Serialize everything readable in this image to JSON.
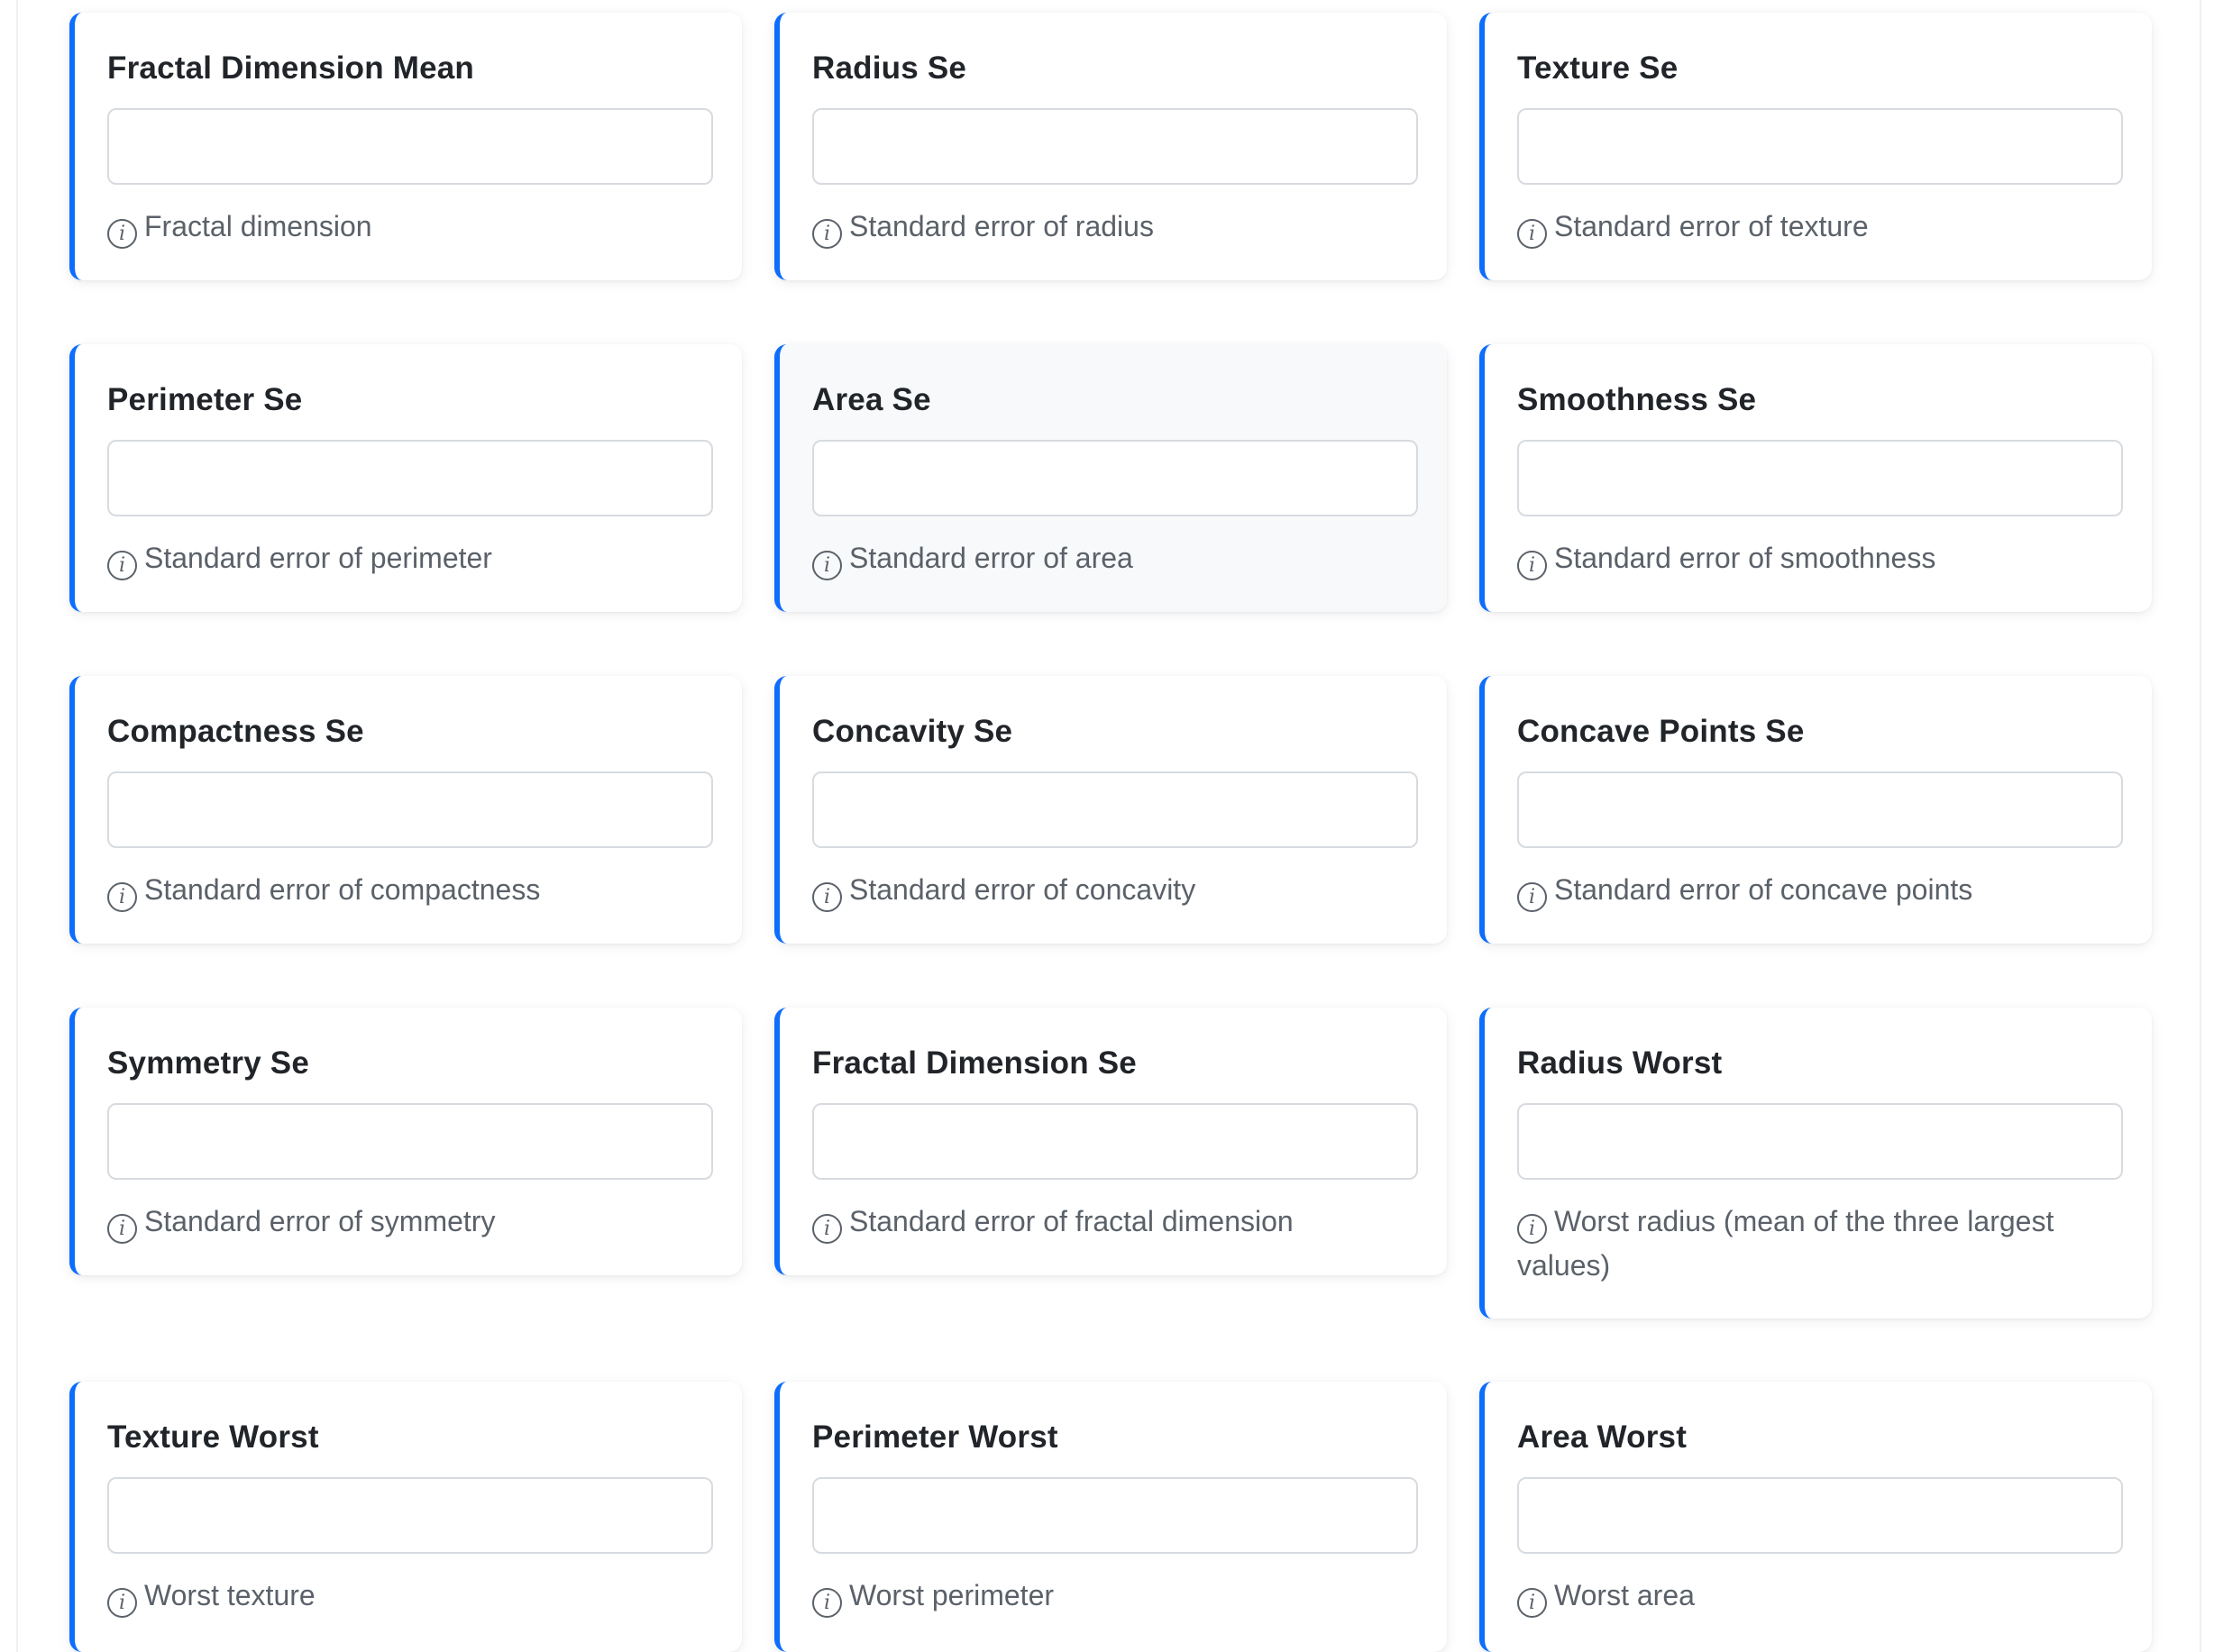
{
  "fields": [
    {
      "label": "Fractal Dimension Mean",
      "help": "Fractal dimension",
      "value": "",
      "placeholder": ""
    },
    {
      "label": "Radius Se",
      "help": "Standard error of radius",
      "value": "",
      "placeholder": ""
    },
    {
      "label": "Texture Se",
      "help": "Standard error of texture",
      "value": "",
      "placeholder": ""
    },
    {
      "label": "Perimeter Se",
      "help": "Standard error of perimeter",
      "value": "",
      "placeholder": ""
    },
    {
      "label": "Area Se",
      "help": "Standard error of area",
      "value": "",
      "placeholder": ""
    },
    {
      "label": "Smoothness Se",
      "help": "Standard error of smoothness",
      "value": "",
      "placeholder": ""
    },
    {
      "label": "Compactness Se",
      "help": "Standard error of compactness",
      "value": "",
      "placeholder": ""
    },
    {
      "label": "Concavity Se",
      "help": "Standard error of concavity",
      "value": "",
      "placeholder": ""
    },
    {
      "label": "Concave Points Se",
      "help": "Standard error of concave points",
      "value": "",
      "placeholder": ""
    },
    {
      "label": "Symmetry Se",
      "help": "Standard error of symmetry",
      "value": "",
      "placeholder": ""
    },
    {
      "label": "Fractal Dimension Se",
      "help": "Standard error of fractal dimension",
      "value": "",
      "placeholder": ""
    },
    {
      "label": "Radius Worst",
      "help": "Worst radius (mean of the three largest values)",
      "value": "",
      "placeholder": ""
    },
    {
      "label": "Texture Worst",
      "help": "Worst texture",
      "value": "",
      "placeholder": ""
    },
    {
      "label": "Perimeter Worst",
      "help": "Worst perimeter",
      "value": "",
      "placeholder": ""
    },
    {
      "label": "Area Worst",
      "help": "Worst area",
      "value": "",
      "placeholder": ""
    }
  ],
  "info_icon": {
    "name": "info-icon",
    "glyph": "i"
  },
  "colors": {
    "accent": "#0d6efd",
    "text": "#212529",
    "muted": "#5b6169",
    "hover_card": "#f8f9fa"
  }
}
